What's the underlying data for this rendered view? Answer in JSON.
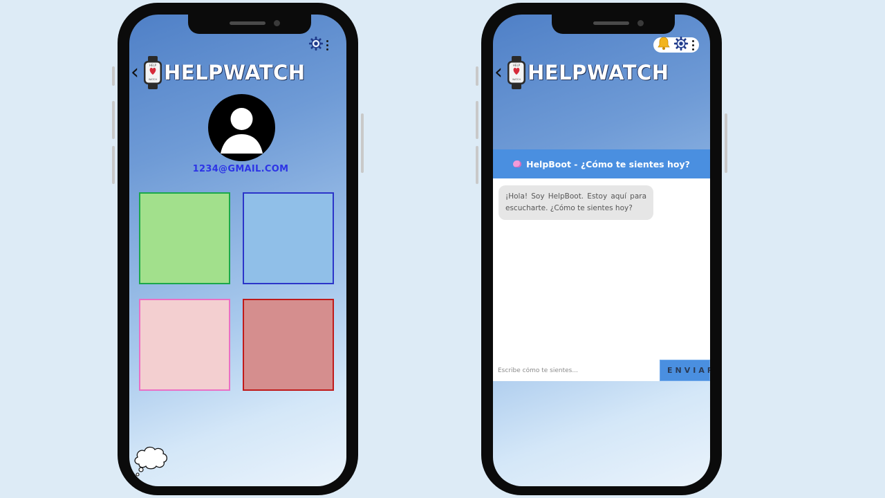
{
  "app": {
    "title": "HELPWATCH",
    "back_glyph": "‹",
    "watch_text": {
      "top": "HELP",
      "bottom": "WATCH"
    }
  },
  "profile_screen": {
    "email": "1234@GMAIL.COM",
    "tiles": [
      {
        "name": "green",
        "fill": "#a2e08c",
        "border": "#1aa84a"
      },
      {
        "name": "blue",
        "fill": "#90bfe8",
        "border": "#2b34c9"
      },
      {
        "name": "pink",
        "fill": "#f3cfd0",
        "border": "#ea6fc4"
      },
      {
        "name": "red",
        "fill": "#d58e8e",
        "border": "#c01a1a"
      }
    ],
    "icons": [
      "gear-icon",
      "more-vertical-icon",
      "thought-bubble-icon",
      "user-avatar-icon"
    ]
  },
  "chat_screen": {
    "header": "HelpBoot - ¿Cómo te sientes hoy?",
    "header_icon": "brain-icon",
    "messages": [
      {
        "from": "bot",
        "text": "¡Hola! Soy HelpBoot. Estoy aquí para escucharte. ¿Cómo te sientes hoy?"
      }
    ],
    "input_placeholder": "Escribe cómo te sientes...",
    "send_label": "ENVIAR",
    "icons": [
      "bell-icon",
      "gear-icon",
      "more-vertical-icon"
    ]
  },
  "colors": {
    "background": "#ddebf6",
    "phone_frame": "#0b0b0b",
    "accent_blue": "#4a8fe0",
    "email_text": "#2d34e6"
  }
}
